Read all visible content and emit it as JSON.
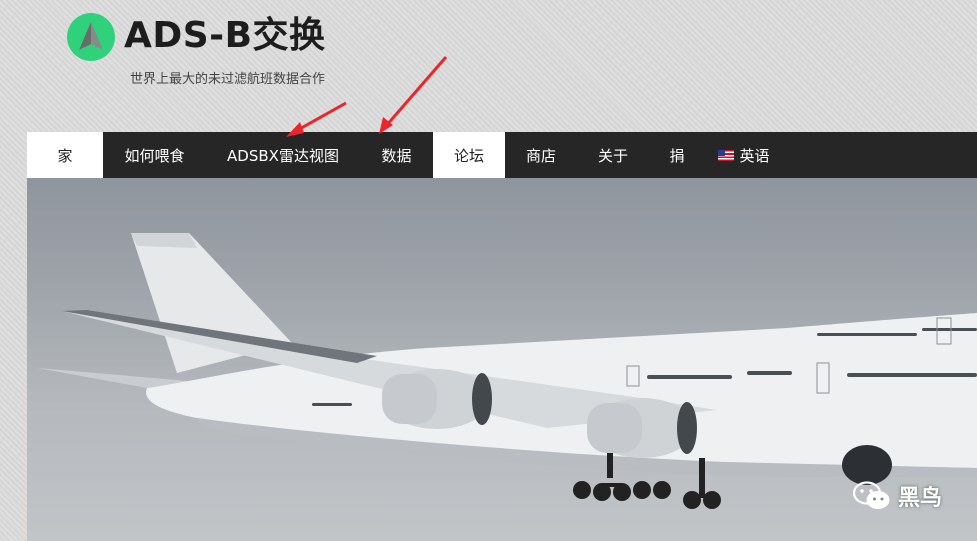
{
  "site": {
    "title": "ADS-B交换",
    "tagline": "世界上最大的未过滤航班数据合作"
  },
  "nav": {
    "items": [
      {
        "label": "家",
        "active": true
      },
      {
        "label": "如何喂食",
        "active": false
      },
      {
        "label": "ADSBX雷达视图",
        "active": false
      },
      {
        "label": "数据",
        "active": false
      },
      {
        "label": "论坛",
        "active": true
      },
      {
        "label": "商店",
        "active": false
      },
      {
        "label": "关于",
        "active": false
      },
      {
        "label": "捐",
        "active": false
      },
      {
        "label": "英语",
        "active": false,
        "icon": "us-flag-icon"
      }
    ]
  },
  "watermark": {
    "text": "黑鸟",
    "icon": "wechat-icon"
  },
  "colors": {
    "logo": "#2fd27a",
    "nav_bg": "#262626",
    "annotation_arrow": "#e8262b"
  }
}
